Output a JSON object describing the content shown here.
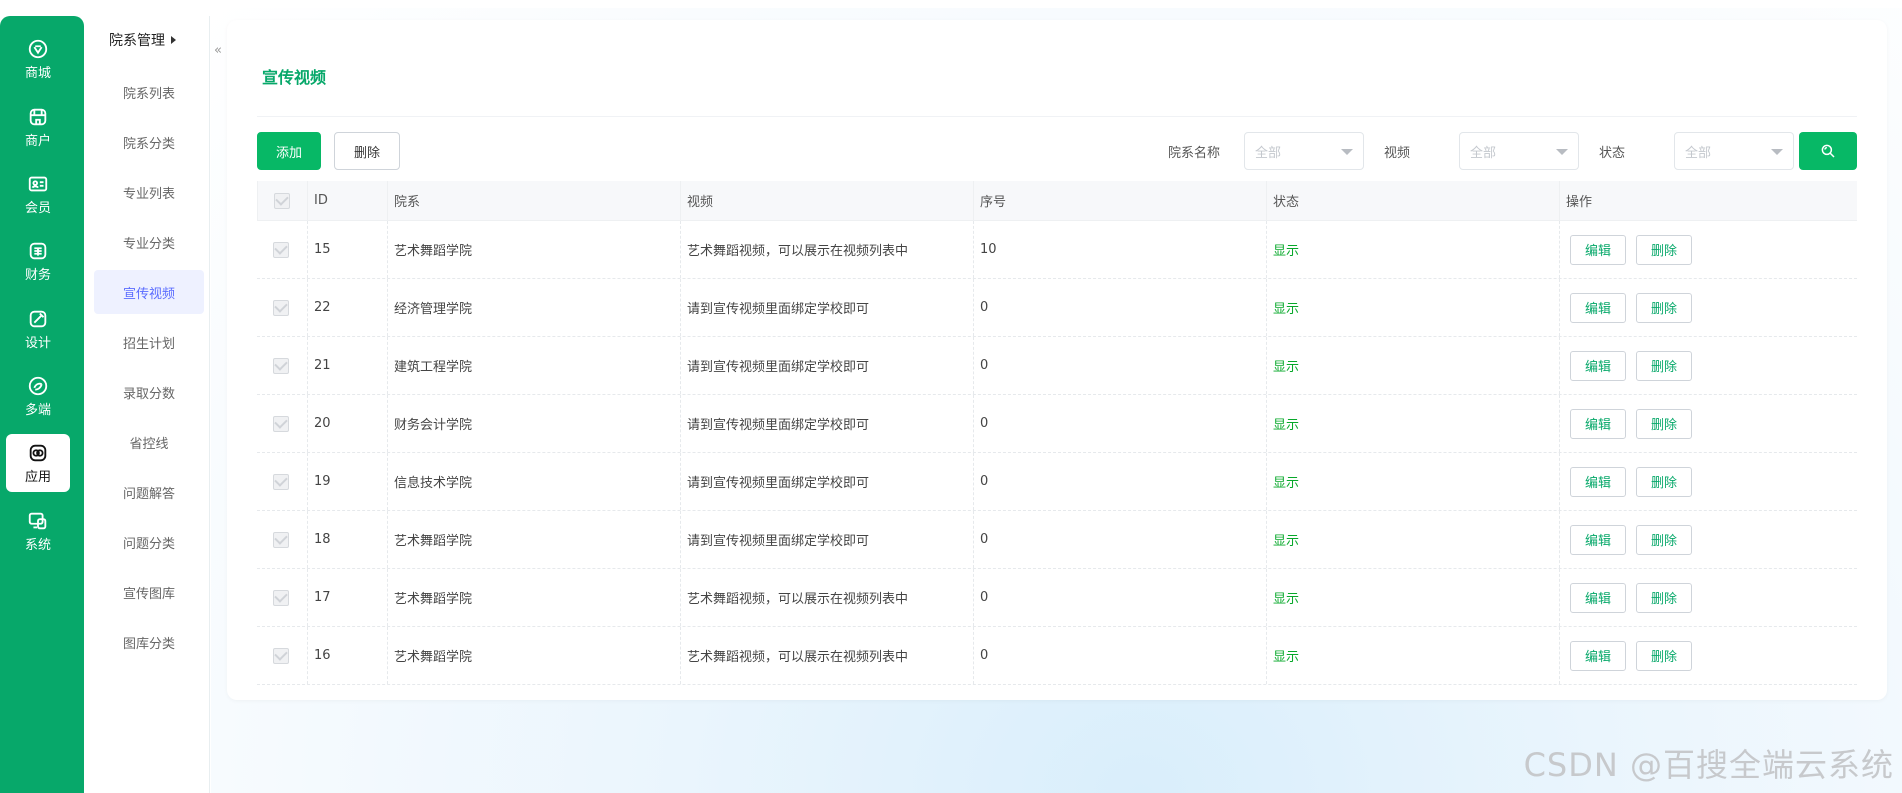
{
  "rail": [
    {
      "label": "商城",
      "icon": "shop-icon"
    },
    {
      "label": "商户",
      "icon": "store-icon"
    },
    {
      "label": "会员",
      "icon": "member-card-icon"
    },
    {
      "label": "财务",
      "icon": "finance-icon"
    },
    {
      "label": "设计",
      "icon": "design-icon"
    },
    {
      "label": "多端",
      "icon": "multiplatform-icon"
    },
    {
      "label": "应用",
      "icon": "apps-icon",
      "active": true
    },
    {
      "label": "系统",
      "icon": "system-icon"
    }
  ],
  "subnav": {
    "title": "院系管理",
    "items": [
      "院系列表",
      "院系分类",
      "专业列表",
      "专业分类",
      "宣传视频",
      "招生计划",
      "录取分数",
      "省控线",
      "问题解答",
      "问题分类",
      "宣传图库",
      "图库分类"
    ],
    "active_index": 4
  },
  "collapse_label": "«",
  "page": {
    "title": "宣传视频",
    "add_label": "添加",
    "delete_label": "删除"
  },
  "filters": {
    "dept_label": "院系名称",
    "dept_value": "全部",
    "video_label": "视频",
    "video_value": "全部",
    "status_label": "状态",
    "status_value": "全部"
  },
  "table": {
    "headers": {
      "id": "ID",
      "dept": "院系",
      "video": "视频",
      "order": "序号",
      "status": "状态",
      "ops": "操作"
    },
    "rows": [
      {
        "id": "15",
        "dept": "艺术舞蹈学院",
        "video": "艺术舞蹈视频，可以展示在视频列表中",
        "order": "10",
        "status": "显示"
      },
      {
        "id": "22",
        "dept": "经济管理学院",
        "video": "请到宣传视频里面绑定学校即可",
        "order": "0",
        "status": "显示"
      },
      {
        "id": "21",
        "dept": "建筑工程学院",
        "video": "请到宣传视频里面绑定学校即可",
        "order": "0",
        "status": "显示"
      },
      {
        "id": "20",
        "dept": "财务会计学院",
        "video": "请到宣传视频里面绑定学校即可",
        "order": "0",
        "status": "显示"
      },
      {
        "id": "19",
        "dept": "信息技术学院",
        "video": "请到宣传视频里面绑定学校即可",
        "order": "0",
        "status": "显示"
      },
      {
        "id": "18",
        "dept": "艺术舞蹈学院",
        "video": "请到宣传视频里面绑定学校即可",
        "order": "0",
        "status": "显示"
      },
      {
        "id": "17",
        "dept": "艺术舞蹈学院",
        "video": "艺术舞蹈视频，可以展示在视频列表中",
        "order": "0",
        "status": "显示"
      },
      {
        "id": "16",
        "dept": "艺术舞蹈学院",
        "video": "艺术舞蹈视频，可以展示在视频列表中",
        "order": "0",
        "status": "显示"
      }
    ],
    "edit_label": "编辑",
    "delete_label": "删除"
  },
  "watermark": "CSDN @百搜全端云系统",
  "colors": {
    "brand": "#07a86a",
    "primary_button": "#07b866",
    "status_show": "#07a82a",
    "active_nav": "#5a6cff"
  }
}
